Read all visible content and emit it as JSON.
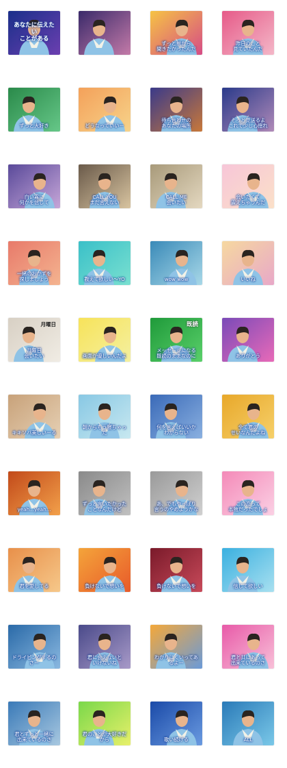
{
  "stickers": [
    {
      "title": "あなたに伝えたい\nことがある",
      "title_sub": "",
      "caption": "",
      "bg": [
        "#1a2f8a",
        "#6b3fb0"
      ]
    },
    {
      "caption": "",
      "bg": [
        "#3a2a6a",
        "#c37aa8"
      ]
    },
    {
      "caption": "ずっと前から\n聞きたかったんだ",
      "bg": [
        "#f6c344",
        "#d64c86"
      ]
    },
    {
      "caption": "昨日のこと\n見ていたんだ",
      "bg": [
        "#e65a88",
        "#f4b7c8"
      ]
    },
    {
      "caption": "ずっと大好き",
      "bg": [
        "#2a8a4a",
        "#66c788"
      ]
    },
    {
      "caption": "どうなっていいー",
      "bg": [
        "#f4a15a",
        "#f6d38a"
      ]
    },
    {
      "caption": "待ち合わせの\nあなたの場所",
      "bg": [
        "#3a3a8a",
        "#c8783a"
      ]
    },
    {
      "caption": "そっと見送るよ\nこれで少し心揺れ",
      "bg": [
        "#2a3a8a",
        "#b08ab8"
      ]
    },
    {
      "caption": "白い霧に\n何かを信じて",
      "bg": [
        "#5a4a9a",
        "#c6a6d8"
      ]
    },
    {
      "caption": "CALL YOU\nまだ言えない",
      "bg": [
        "#6a5a4a",
        "#d8c4a0"
      ]
    },
    {
      "caption": "CALL ME\n会いたい",
      "bg": [
        "#a89a7a",
        "#e4d8c0"
      ]
    },
    {
      "caption": "会いたくて\n震えちゃうんだ",
      "bg": [
        "#f7c6d8",
        "#fbe0c8"
      ]
    },
    {
      "caption": "一緒のおかずを\n探しましょう",
      "bg": [
        "#e87a6a",
        "#f4b490"
      ]
    },
    {
      "caption": "教えて欲しい～YO",
      "bg": [
        "#3ac0c8",
        "#7ae0d0"
      ]
    },
    {
      "caption": "wow  wow",
      "bg": [
        "#3a8ab8",
        "#a8d8e8"
      ]
    },
    {
      "caption": "いいね",
      "bg": [
        "#f6d8a0",
        "#e8a8c8"
      ]
    },
    {
      "caption": "月曜日\n会いたい",
      "cal": "月曜日",
      "bg": [
        "#d8d0c4",
        "#f0ece4"
      ]
    },
    {
      "caption": "画面が優しいんだよ",
      "bg": [
        "#f7e35a",
        "#f4f0a0"
      ]
    },
    {
      "caption": "メッセージになる\n既読のままなのに",
      "sign": "既読",
      "bg": [
        "#1f9a3a",
        "#5ad06a"
      ]
    },
    {
      "caption": "ありがとう",
      "bg": [
        "#7a4ab8",
        "#e86ab8"
      ]
    },
    {
      "caption": "キキソバ美しいーる",
      "bg": [
        "#c8a27a",
        "#e6d0b4"
      ]
    },
    {
      "caption": "朝からもう寝ちゃった",
      "bg": [
        "#88c8e4",
        "#c8e8f0"
      ]
    },
    {
      "caption": "何を言えばいいか\nわからない",
      "bg": [
        "#3a6ab8",
        "#8ab0e0"
      ]
    },
    {
      "caption": "全て君の\nせいなんだよね",
      "bg": [
        "#e8a82a",
        "#f6d06a"
      ]
    },
    {
      "caption": "yeah...yeah...",
      "bg": [
        "#c24a1a",
        "#f2a04a"
      ]
    },
    {
      "caption": "ずっと言いたかった\nことなんだけど",
      "bg": [
        "#8a8a8a",
        "#c0c0c0"
      ]
    },
    {
      "caption": "あ、でもやっぱり\n言うのやめようかな",
      "bg": [
        "#9a9a9a",
        "#d0d0d0"
      ]
    },
    {
      "caption": "この恋って\n本物だったでしょ",
      "bg": [
        "#f48ab8",
        "#fbd0e4"
      ]
    },
    {
      "caption": "君を愛してる",
      "bg": [
        "#e8904a",
        "#f6c88a"
      ]
    },
    {
      "caption": "負けないで想いを",
      "bg": [
        "#f4a43a",
        "#e85a2a"
      ]
    },
    {
      "caption": "負けないで想いを",
      "bg": [
        "#7a1a2a",
        "#c84a5a"
      ]
    },
    {
      "caption": "信じて欲しい",
      "bg": [
        "#3ab0e0",
        "#a8e0f0"
      ]
    },
    {
      "caption": "ドライビングするのさー",
      "bg": [
        "#2a6aa8",
        "#8ab8e0"
      ]
    },
    {
      "caption": "君に会えないと\nいけないね",
      "bg": [
        "#4a4a8a",
        "#a89ac8"
      ]
    },
    {
      "caption": "わかりにくいってあるよー",
      "bg": [
        "#f4a83a",
        "#6a9ad8"
      ]
    },
    {
      "caption": "君と共にあって\n出来ているのさ",
      "bg": [
        "#e85aa8",
        "#f8c0d8"
      ]
    },
    {
      "caption": "君とずっと一緒に\n出来ているのさ",
      "bg": [
        "#3a7ab8",
        "#a8c8e0"
      ]
    },
    {
      "caption": "君のことが大好きだから",
      "bg": [
        "#7ad84a",
        "#e8f06a"
      ]
    },
    {
      "caption": "歌い続ける",
      "bg": [
        "#1a4aa8",
        "#6a9ae0"
      ]
    },
    {
      "caption": "ALL",
      "bg": [
        "#2a7ab8",
        "#7ac8e8"
      ]
    }
  ]
}
